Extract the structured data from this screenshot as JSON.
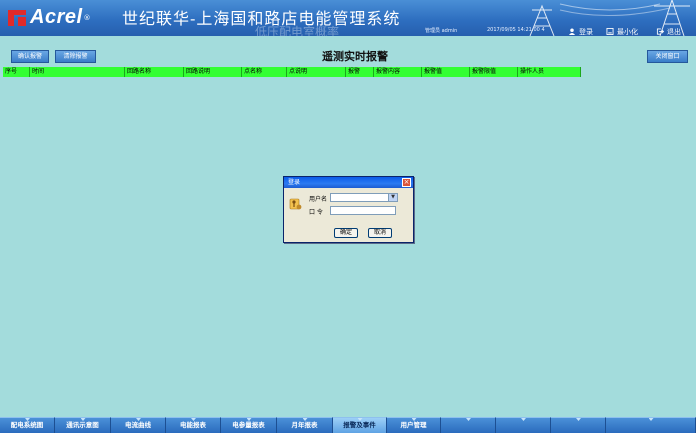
{
  "header": {
    "logo_text": "Acrel",
    "logo_reg": "®",
    "title": "世纪联华-上海国和路店电能管理系统",
    "subtitle_ghost": "低压配电室概率",
    "status_user": "管理员 admin",
    "status_time": "2017/09/05 14:21:00 4",
    "login_label": "登录",
    "minimize_label": "最小化",
    "exit_label": "退出"
  },
  "toolbar": {
    "confirm_alarm_label": "确认报警",
    "clear_alarm_label": "清除报警",
    "page_title": "遥测实时报警",
    "close_window_label": "关闭窗口"
  },
  "table": {
    "columns": [
      "序号",
      "时间",
      "回路名称",
      "回路说明",
      "点名称",
      "点说明",
      "报警",
      "报警内容",
      "报警值",
      "报警限值",
      "操作人员"
    ]
  },
  "dialog": {
    "title": "登录",
    "username_label": "用户名",
    "username_value": "",
    "password_label": "口 令",
    "password_value": "",
    "ok_label": "确定",
    "cancel_label": "取消"
  },
  "nav": {
    "tabs": [
      {
        "label": "配电系统图"
      },
      {
        "label": "通讯示意图"
      },
      {
        "label": "电流曲线"
      },
      {
        "label": "电能报表"
      },
      {
        "label": "电参量报表"
      },
      {
        "label": "月年报表"
      },
      {
        "label": "报警及事件"
      },
      {
        "label": "用户管理"
      },
      {
        "label": ""
      },
      {
        "label": ""
      },
      {
        "label": ""
      },
      {
        "label": ""
      }
    ],
    "active_index": 6
  },
  "colors": {
    "background": "#a3dcdc",
    "header_blue": "#2e6fc0",
    "table_header_green": "#33ff33",
    "logo_red": "#e02a2a"
  }
}
